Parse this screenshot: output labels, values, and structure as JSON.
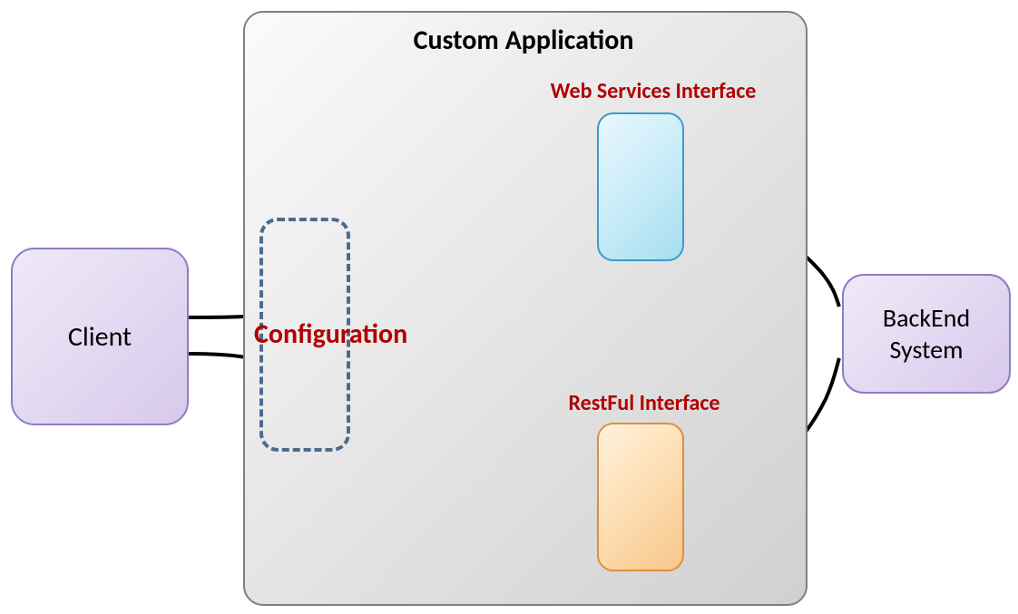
{
  "app": {
    "title": "Custom Application"
  },
  "client": {
    "label": "Client"
  },
  "backend": {
    "label": "BackEnd System"
  },
  "configuration": {
    "label": "Configuration"
  },
  "web_services": {
    "label": "Web Services Interface"
  },
  "restful": {
    "label": "RestFul Interface"
  }
}
